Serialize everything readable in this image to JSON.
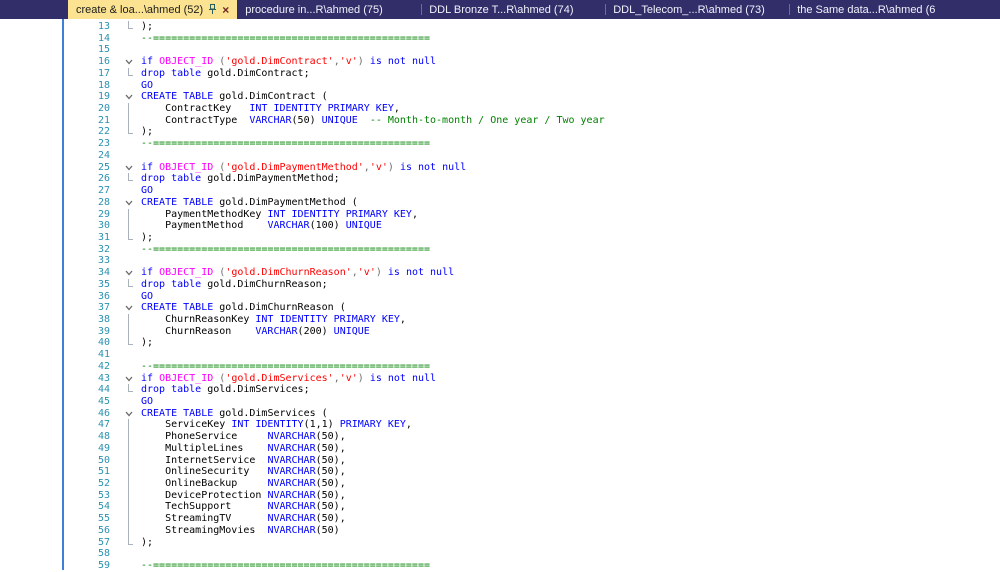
{
  "colors": {
    "tabbar_bg": "#312e6a",
    "tab_text": "#f2f2fb",
    "tab_separator": "#6d6aa8",
    "active_tab_bg": "#fbe391",
    "active_tab_text": "#1c1c1c",
    "close_color": "#6e2424",
    "pin_color": "#2a5d5d",
    "editor_bg": "#ffffff",
    "left_rule": "#3f7fd6",
    "line_number": "#2b91af",
    "fold_line": "#a9b2ba",
    "fold_chevron": "#6a6a6a",
    "kw": "#0000ff",
    "ident": "#000000",
    "string": "#ff0000",
    "comment": "#008000",
    "sysfn": "#ff00ff",
    "gray": "#6e6e6e"
  },
  "icons": {
    "close": "×",
    "pin": "pushpin-icon"
  },
  "tabs": [
    {
      "label": "create & loa...\\ahmed (52)",
      "active": true,
      "pinned": true
    },
    {
      "label": "procedure in...R\\ahmed (75)",
      "active": false
    },
    {
      "label": "DDL Bronze T...R\\ahmed (74)",
      "active": false
    },
    {
      "label": "DDL_Telecom_...R\\ahmed (73)",
      "active": false
    },
    {
      "label": "the Same data...R\\ahmed (6",
      "active": false
    }
  ],
  "editor": {
    "lines": [
      {
        "n": 13,
        "fold": "end",
        "tokens": [
          [
            ");",
            "t"
          ]
        ]
      },
      {
        "n": 14,
        "fold": "none",
        "tokens": [
          [
            "--==============================================",
            "c"
          ]
        ]
      },
      {
        "n": 15,
        "fold": "none",
        "tokens": []
      },
      {
        "n": 16,
        "fold": "chevron",
        "tokens": [
          [
            "if ",
            "k"
          ],
          [
            "OBJECT_ID ",
            "f"
          ],
          [
            "(",
            "g"
          ],
          [
            "'gold.DimContract'",
            "s"
          ],
          [
            ",",
            "g"
          ],
          [
            "'v'",
            "s"
          ],
          [
            ") ",
            "g"
          ],
          [
            "is not null",
            "k"
          ]
        ]
      },
      {
        "n": 17,
        "fold": "end",
        "tokens": [
          [
            "drop table ",
            "k"
          ],
          [
            "gold.DimContract;",
            "t"
          ]
        ]
      },
      {
        "n": 18,
        "fold": "none",
        "tokens": [
          [
            "GO",
            "k"
          ]
        ]
      },
      {
        "n": 19,
        "fold": "chevron",
        "tokens": [
          [
            "CREATE TABLE ",
            "k"
          ],
          [
            "gold.DimContract (",
            "t"
          ]
        ]
      },
      {
        "n": 20,
        "fold": "line",
        "tokens": [
          [
            "    ContractKey   ",
            "t"
          ],
          [
            "INT IDENTITY PRIMARY KEY",
            "k"
          ],
          [
            ",",
            "t"
          ]
        ]
      },
      {
        "n": 21,
        "fold": "line",
        "tokens": [
          [
            "    ContractType  ",
            "t"
          ],
          [
            "VARCHAR",
            "k"
          ],
          [
            "(50) ",
            "t"
          ],
          [
            "UNIQUE",
            "k"
          ],
          [
            "  ",
            "t"
          ],
          [
            "-- Month-to-month / One year / Two year",
            "c"
          ]
        ]
      },
      {
        "n": 22,
        "fold": "end",
        "tokens": [
          [
            ");",
            "t"
          ]
        ]
      },
      {
        "n": 23,
        "fold": "none",
        "tokens": [
          [
            "--==============================================",
            "c"
          ]
        ]
      },
      {
        "n": 24,
        "fold": "none",
        "tokens": []
      },
      {
        "n": 25,
        "fold": "chevron",
        "tokens": [
          [
            "if ",
            "k"
          ],
          [
            "OBJECT_ID ",
            "f"
          ],
          [
            "(",
            "g"
          ],
          [
            "'gold.DimPaymentMethod'",
            "s"
          ],
          [
            ",",
            "g"
          ],
          [
            "'v'",
            "s"
          ],
          [
            ") ",
            "g"
          ],
          [
            "is not null",
            "k"
          ]
        ]
      },
      {
        "n": 26,
        "fold": "end",
        "tokens": [
          [
            "drop table ",
            "k"
          ],
          [
            "gold.DimPaymentMethod;",
            "t"
          ]
        ]
      },
      {
        "n": 27,
        "fold": "none",
        "tokens": [
          [
            "GO",
            "k"
          ]
        ]
      },
      {
        "n": 28,
        "fold": "chevron",
        "tokens": [
          [
            "CREATE TABLE ",
            "k"
          ],
          [
            "gold.DimPaymentMethod (",
            "t"
          ]
        ]
      },
      {
        "n": 29,
        "fold": "line",
        "tokens": [
          [
            "    PaymentMethodKey ",
            "t"
          ],
          [
            "INT IDENTITY PRIMARY KEY",
            "k"
          ],
          [
            ",",
            "t"
          ]
        ]
      },
      {
        "n": 30,
        "fold": "line",
        "tokens": [
          [
            "    PaymentMethod    ",
            "t"
          ],
          [
            "VARCHAR",
            "k"
          ],
          [
            "(100) ",
            "t"
          ],
          [
            "UNIQUE",
            "k"
          ]
        ]
      },
      {
        "n": 31,
        "fold": "end",
        "tokens": [
          [
            ");",
            "t"
          ]
        ]
      },
      {
        "n": 32,
        "fold": "none",
        "tokens": [
          [
            "--==============================================",
            "c"
          ]
        ]
      },
      {
        "n": 33,
        "fold": "none",
        "tokens": []
      },
      {
        "n": 34,
        "fold": "chevron",
        "tokens": [
          [
            "if ",
            "k"
          ],
          [
            "OBJECT_ID ",
            "f"
          ],
          [
            "(",
            "g"
          ],
          [
            "'gold.DimChurnReason'",
            "s"
          ],
          [
            ",",
            "g"
          ],
          [
            "'v'",
            "s"
          ],
          [
            ") ",
            "g"
          ],
          [
            "is not null",
            "k"
          ]
        ]
      },
      {
        "n": 35,
        "fold": "end",
        "tokens": [
          [
            "drop table ",
            "k"
          ],
          [
            "gold.DimChurnReason;",
            "t"
          ]
        ]
      },
      {
        "n": 36,
        "fold": "none",
        "tokens": [
          [
            "GO",
            "k"
          ]
        ]
      },
      {
        "n": 37,
        "fold": "chevron",
        "tokens": [
          [
            "CREATE TABLE ",
            "k"
          ],
          [
            "gold.DimChurnReason (",
            "t"
          ]
        ]
      },
      {
        "n": 38,
        "fold": "line",
        "tokens": [
          [
            "    ChurnReasonKey ",
            "t"
          ],
          [
            "INT IDENTITY PRIMARY KEY",
            "k"
          ],
          [
            ",",
            "t"
          ]
        ]
      },
      {
        "n": 39,
        "fold": "line",
        "tokens": [
          [
            "    ChurnReason    ",
            "t"
          ],
          [
            "VARCHAR",
            "k"
          ],
          [
            "(200) ",
            "t"
          ],
          [
            "UNIQUE",
            "k"
          ]
        ]
      },
      {
        "n": 40,
        "fold": "end",
        "tokens": [
          [
            ");",
            "t"
          ]
        ]
      },
      {
        "n": 41,
        "fold": "none",
        "tokens": []
      },
      {
        "n": 42,
        "fold": "none",
        "tokens": [
          [
            "--==============================================",
            "c"
          ]
        ]
      },
      {
        "n": 43,
        "fold": "chevron",
        "tokens": [
          [
            "if ",
            "k"
          ],
          [
            "OBJECT_ID ",
            "f"
          ],
          [
            "(",
            "g"
          ],
          [
            "'gold.DimServices'",
            "s"
          ],
          [
            ",",
            "g"
          ],
          [
            "'v'",
            "s"
          ],
          [
            ") ",
            "g"
          ],
          [
            "is not null",
            "k"
          ]
        ]
      },
      {
        "n": 44,
        "fold": "end",
        "tokens": [
          [
            "drop table ",
            "k"
          ],
          [
            "gold.DimServices;",
            "t"
          ]
        ]
      },
      {
        "n": 45,
        "fold": "none",
        "tokens": [
          [
            "GO",
            "k"
          ]
        ]
      },
      {
        "n": 46,
        "fold": "chevron",
        "tokens": [
          [
            "CREATE TABLE ",
            "k"
          ],
          [
            "gold.DimServices (",
            "t"
          ]
        ]
      },
      {
        "n": 47,
        "fold": "line",
        "tokens": [
          [
            "    ServiceKey ",
            "t"
          ],
          [
            "INT IDENTITY",
            "k"
          ],
          [
            "(1,1) ",
            "t"
          ],
          [
            "PRIMARY KEY",
            "k"
          ],
          [
            ",",
            "t"
          ]
        ]
      },
      {
        "n": 48,
        "fold": "line",
        "tokens": [
          [
            "    PhoneService     ",
            "t"
          ],
          [
            "NVARCHAR",
            "k"
          ],
          [
            "(50),",
            "t"
          ]
        ]
      },
      {
        "n": 49,
        "fold": "line",
        "tokens": [
          [
            "    MultipleLines    ",
            "t"
          ],
          [
            "NVARCHAR",
            "k"
          ],
          [
            "(50),",
            "t"
          ]
        ]
      },
      {
        "n": 50,
        "fold": "line",
        "tokens": [
          [
            "    InternetService  ",
            "t"
          ],
          [
            "NVARCHAR",
            "k"
          ],
          [
            "(50),",
            "t"
          ]
        ]
      },
      {
        "n": 51,
        "fold": "line",
        "tokens": [
          [
            "    OnlineSecurity   ",
            "t"
          ],
          [
            "NVARCHAR",
            "k"
          ],
          [
            "(50),",
            "t"
          ]
        ]
      },
      {
        "n": 52,
        "fold": "line",
        "tokens": [
          [
            "    OnlineBackup     ",
            "t"
          ],
          [
            "NVARCHAR",
            "k"
          ],
          [
            "(50),",
            "t"
          ]
        ]
      },
      {
        "n": 53,
        "fold": "line",
        "tokens": [
          [
            "    DeviceProtection ",
            "t"
          ],
          [
            "NVARCHAR",
            "k"
          ],
          [
            "(50),",
            "t"
          ]
        ]
      },
      {
        "n": 54,
        "fold": "line",
        "tokens": [
          [
            "    TechSupport      ",
            "t"
          ],
          [
            "NVARCHAR",
            "k"
          ],
          [
            "(50),",
            "t"
          ]
        ]
      },
      {
        "n": 55,
        "fold": "line",
        "tokens": [
          [
            "    StreamingTV      ",
            "t"
          ],
          [
            "NVARCHAR",
            "k"
          ],
          [
            "(50),",
            "t"
          ]
        ]
      },
      {
        "n": 56,
        "fold": "line",
        "tokens": [
          [
            "    StreamingMovies  ",
            "t"
          ],
          [
            "NVARCHAR",
            "k"
          ],
          [
            "(50)",
            "t"
          ]
        ]
      },
      {
        "n": 57,
        "fold": "end",
        "tokens": [
          [
            ");",
            "t"
          ]
        ]
      },
      {
        "n": 58,
        "fold": "none",
        "tokens": []
      },
      {
        "n": 59,
        "fold": "none",
        "tokens": [
          [
            "--==============================================",
            "c"
          ]
        ]
      }
    ]
  }
}
